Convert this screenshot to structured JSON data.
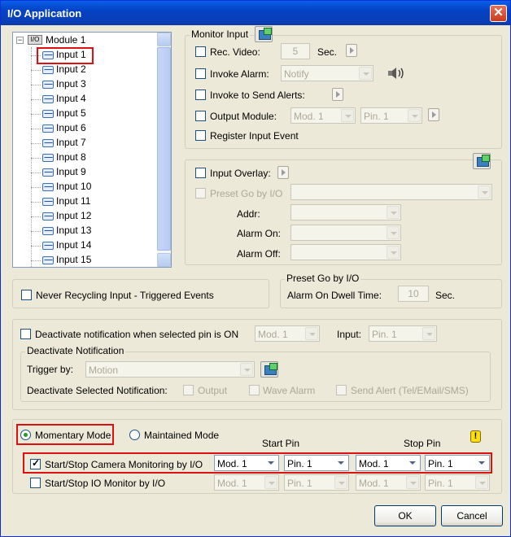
{
  "window": {
    "title": "I/O Application",
    "close_glyph": "✕"
  },
  "tree": {
    "module_label": "Module 1",
    "module_tag": "I/O",
    "expander": "−",
    "items": [
      "Input 1",
      "Input 2",
      "Input 3",
      "Input 4",
      "Input 5",
      "Input 6",
      "Input 7",
      "Input 8",
      "Input 9",
      "Input 10",
      "Input 11",
      "Input 12",
      "Input 13",
      "Input 14",
      "Input 15"
    ],
    "selected_index": 0
  },
  "monitor_input": {
    "legend": "Monitor Input",
    "rec_video_label": "Rec. Video:",
    "rec_video_value": "5",
    "rec_video_unit": "Sec.",
    "invoke_alarm_label": "Invoke Alarm:",
    "invoke_alarm_value": "Notify",
    "invoke_send_alerts_label": "Invoke to Send Alerts:",
    "output_module_label": "Output Module:",
    "output_module_value": "Mod. 1",
    "output_pin_value": "Pin. 1",
    "register_event_label": "Register Input Event"
  },
  "overlay": {
    "input_overlay_label": "Input Overlay:",
    "preset_go_label": "Preset Go by I/O",
    "addr_label": "Addr:",
    "alarm_on_label": "Alarm On:",
    "alarm_off_label": "Alarm Off:"
  },
  "never_recycling_label": "Never Recycling Input - Triggered Events",
  "preset_dwell": {
    "legend": "Preset Go by I/O",
    "label": "Alarm On Dwell Time:",
    "value": "10",
    "unit": "Sec."
  },
  "deactivate": {
    "checkbox_label": "Deactivate notification when selected pin is ON",
    "module_value": "Mod. 1",
    "input_label": "Input:",
    "pin_value": "Pin. 1",
    "legend": "Deactivate Notification",
    "trigger_label": "Trigger by:",
    "trigger_value": "Motion",
    "selected_label": "Deactivate Selected Notification:",
    "output_label": "Output",
    "wave_label": "Wave Alarm",
    "send_alert_label": "Send Alert (Tel/EMail/SMS)"
  },
  "mode": {
    "momentary_label": "Momentary Mode",
    "maintained_label": "Maintained Mode",
    "start_pin_header": "Start Pin",
    "stop_pin_header": "Stop Pin",
    "warn_glyph": "!",
    "camera_row": {
      "label": "Start/Stop Camera Monitoring by I/O",
      "start_mod": "Mod. 1",
      "start_pin": "Pin. 1",
      "stop_mod": "Mod. 1",
      "stop_pin": "Pin. 1"
    },
    "io_row": {
      "label": "Start/Stop IO Monitor by I/O",
      "start_mod": "Mod. 1",
      "start_pin": "Pin. 1",
      "stop_mod": "Mod. 1",
      "stop_pin": "Pin. 1"
    }
  },
  "buttons": {
    "ok": "OK",
    "cancel": "Cancel"
  },
  "checkmark_glyph": "✓",
  "colors": {
    "title_bar": "#0442c4",
    "highlight": "#e01010",
    "face": "#ece9d8"
  }
}
